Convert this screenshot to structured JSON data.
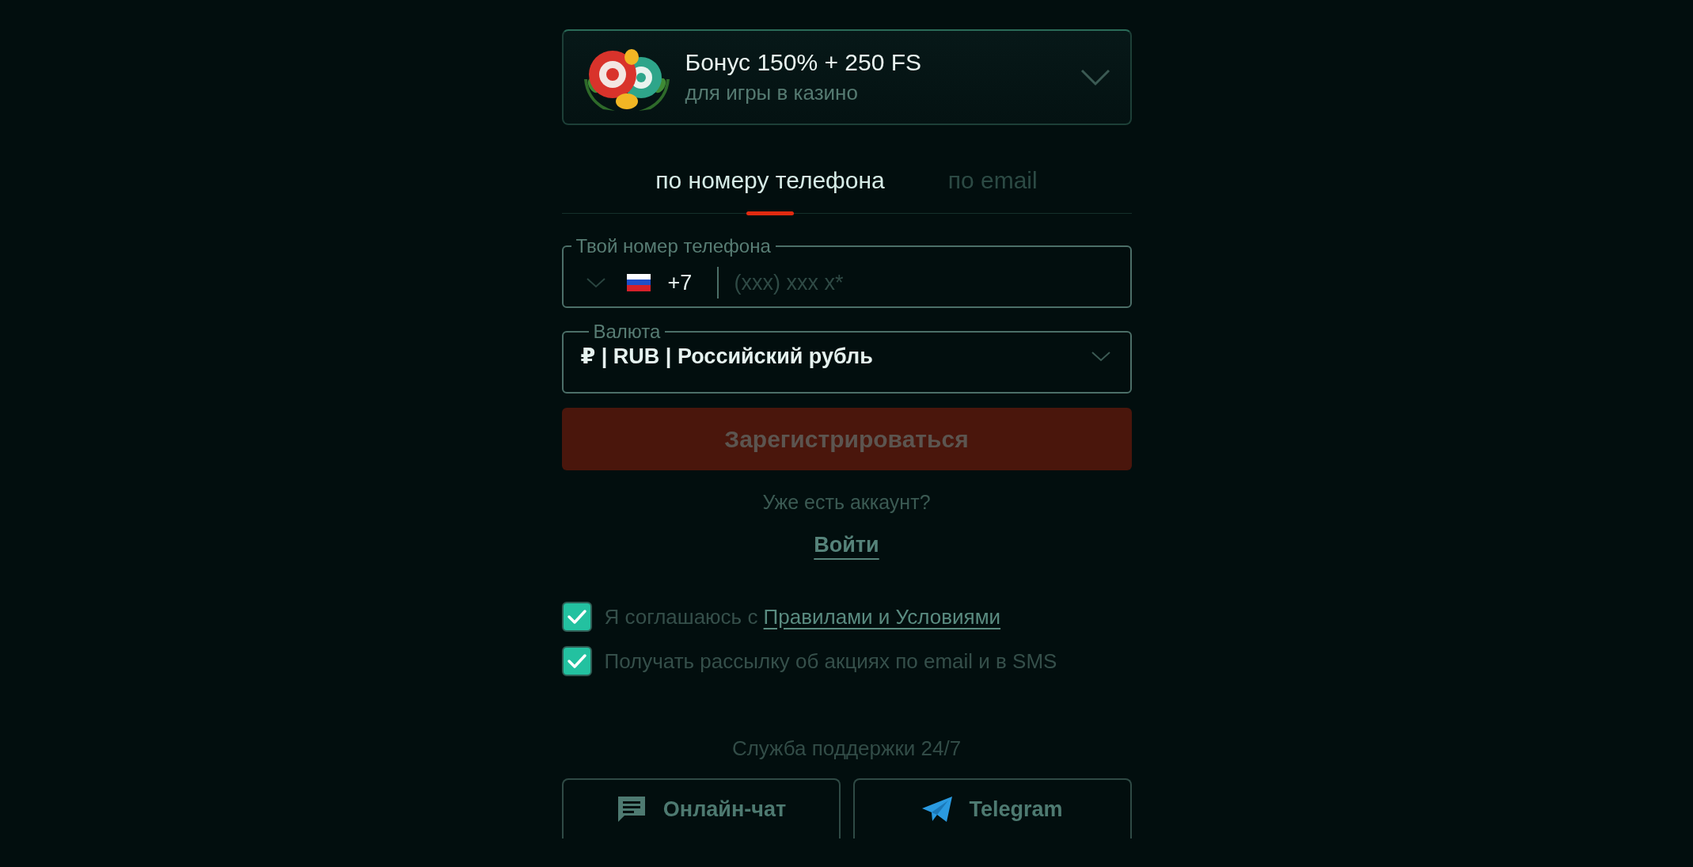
{
  "bonus": {
    "title": "Бонус 150% + 250 FS",
    "subtitle": "для игры в казино",
    "expanded": false
  },
  "tabs": [
    {
      "label": "по номеру телефона",
      "selected": true
    },
    {
      "label": "по email",
      "selected": false
    }
  ],
  "phone": {
    "label": "Твой номер телефона",
    "code": "+7",
    "placeholder": "(xxx) xxx x*"
  },
  "currency": {
    "label": "Валюта",
    "value": "₽ | RUB | Российский рубль"
  },
  "register_button": {
    "label": "Зарегистрироваться",
    "disabled": true
  },
  "login": {
    "prompt": "Уже есть аккаунт?",
    "link": "Войти"
  },
  "checkboxes": [
    {
      "text": "Я соглашаюсь с ",
      "link": "Правилами и Условиями",
      "checked": true
    },
    {
      "text": "Получать рассылку об акциях по email и в SMS",
      "checked": true
    }
  ],
  "support": {
    "title": "Служба поддержки 24/7",
    "buttons": [
      {
        "kind": "chat",
        "label": "Онлайн-чат"
      },
      {
        "kind": "telegram",
        "label": "Telegram"
      }
    ]
  }
}
